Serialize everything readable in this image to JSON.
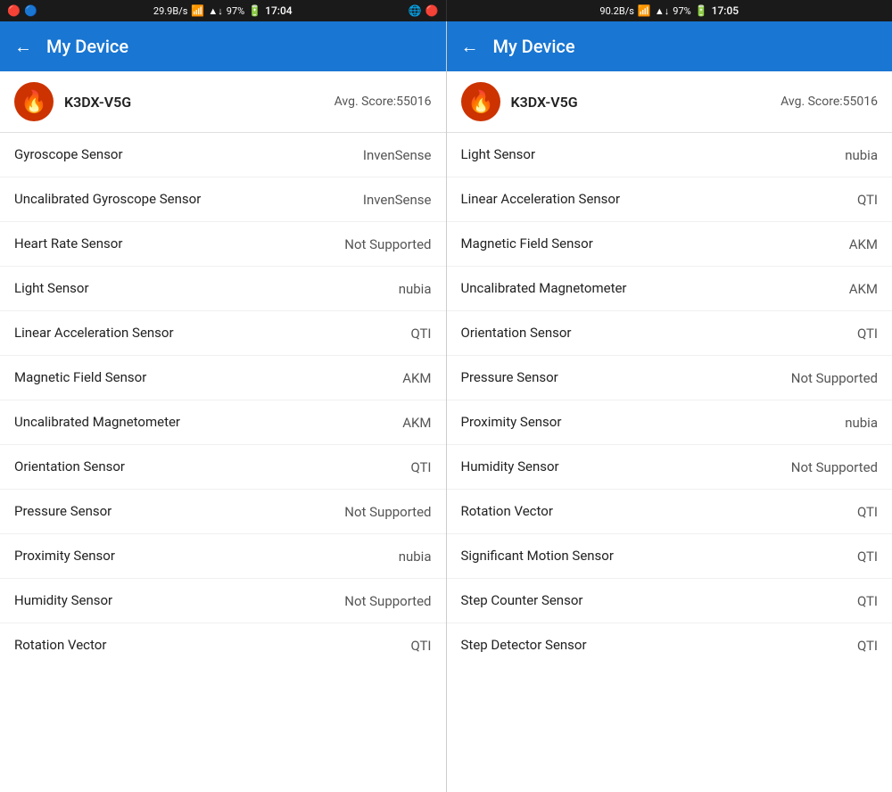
{
  "status_bars": [
    {
      "id": "left",
      "left_icons": "🔴 🔵",
      "network_speed": "29.9B/s",
      "wifi": "📶",
      "signal": "📶",
      "battery_pct": "97%",
      "battery_icon": "🔋",
      "time": "17:04",
      "right_icons": "🌐 🔴"
    },
    {
      "id": "right",
      "left_icons": "",
      "network_speed": "90.2B/s",
      "wifi": "📶",
      "signal": "📶",
      "battery_pct": "97%",
      "battery_icon": "🔋",
      "time": "17:05",
      "right_icons": ""
    }
  ],
  "panels": [
    {
      "id": "left-panel",
      "header": {
        "back_label": "←",
        "title": "My Device"
      },
      "device": {
        "name": "K3DX-V5G",
        "avg_score_label": "Avg. Score:55016"
      },
      "sensors": [
        {
          "name": "Gyroscope Sensor",
          "value": "InvenSense"
        },
        {
          "name": "Uncalibrated Gyroscope Sensor",
          "value": "InvenSense"
        },
        {
          "name": "Heart Rate Sensor",
          "value": "Not Supported"
        },
        {
          "name": "Light Sensor",
          "value": "nubia"
        },
        {
          "name": "Linear Acceleration Sensor",
          "value": "QTI"
        },
        {
          "name": "Magnetic Field Sensor",
          "value": "AKM"
        },
        {
          "name": "Uncalibrated Magnetometer",
          "value": "AKM"
        },
        {
          "name": "Orientation Sensor",
          "value": "QTI"
        },
        {
          "name": "Pressure Sensor",
          "value": "Not Supported"
        },
        {
          "name": "Proximity Sensor",
          "value": "nubia"
        },
        {
          "name": "Humidity Sensor",
          "value": "Not Supported"
        },
        {
          "name": "Rotation Vector",
          "value": "QTI"
        }
      ]
    },
    {
      "id": "right-panel",
      "header": {
        "back_label": "←",
        "title": "My Device"
      },
      "device": {
        "name": "K3DX-V5G",
        "avg_score_label": "Avg. Score:55016"
      },
      "sensors": [
        {
          "name": "Light Sensor",
          "value": "nubia"
        },
        {
          "name": "Linear Acceleration Sensor",
          "value": "QTI"
        },
        {
          "name": "Magnetic Field Sensor",
          "value": "AKM"
        },
        {
          "name": "Uncalibrated Magnetometer",
          "value": "AKM"
        },
        {
          "name": "Orientation Sensor",
          "value": "QTI"
        },
        {
          "name": "Pressure Sensor",
          "value": "Not Supported"
        },
        {
          "name": "Proximity Sensor",
          "value": "nubia"
        },
        {
          "name": "Humidity Sensor",
          "value": "Not Supported"
        },
        {
          "name": "Rotation Vector",
          "value": "QTI"
        },
        {
          "name": "Significant Motion Sensor",
          "value": "QTI"
        },
        {
          "name": "Step Counter Sensor",
          "value": "QTI"
        },
        {
          "name": "Step Detector Sensor",
          "value": "QTI"
        }
      ]
    }
  ],
  "icons": {
    "back_arrow": "←",
    "flame_emoji": "🔥"
  }
}
